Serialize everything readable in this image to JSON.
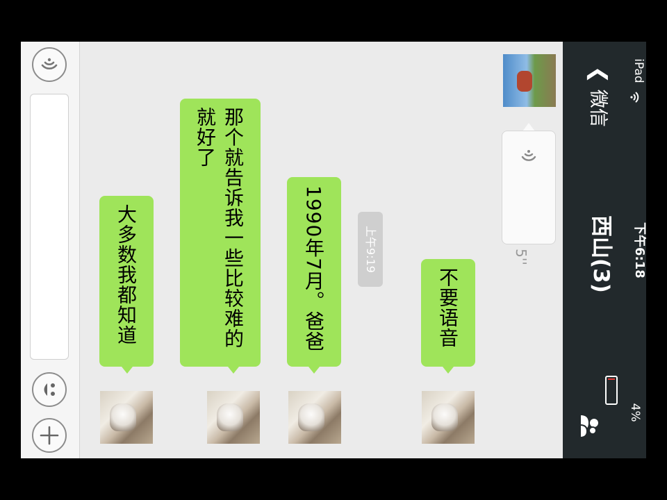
{
  "status_bar": {
    "carrier": "iPad",
    "time": "下午6:18",
    "battery": "4%"
  },
  "nav_bar": {
    "back_label": "微信",
    "title": "西山(3)",
    "right_icon": "group-members-icon"
  },
  "messages": [
    {
      "sender": "other",
      "type": "voice",
      "duration": "5''"
    },
    {
      "sender": "self",
      "type": "text",
      "text": "不要语音"
    },
    {
      "type": "timestamp",
      "text": "上午9:19"
    },
    {
      "sender": "self",
      "type": "text",
      "text": "1990年7月。爸爸"
    },
    {
      "sender": "self",
      "type": "text",
      "text": "那个就告诉我一些比较难的就好了"
    },
    {
      "sender": "self",
      "type": "text",
      "text": "大多数我都知道"
    }
  ],
  "input_bar": {
    "voice_icon": "voice-mode-icon",
    "emoji_icon": "emoji-icon",
    "plus_icon": "plus-icon",
    "text_value": ""
  },
  "colors": {
    "nav_background": "#22292c",
    "chat_background": "#ebebeb",
    "self_bubble": "#9fe45a",
    "other_bubble": "#fafafa"
  }
}
